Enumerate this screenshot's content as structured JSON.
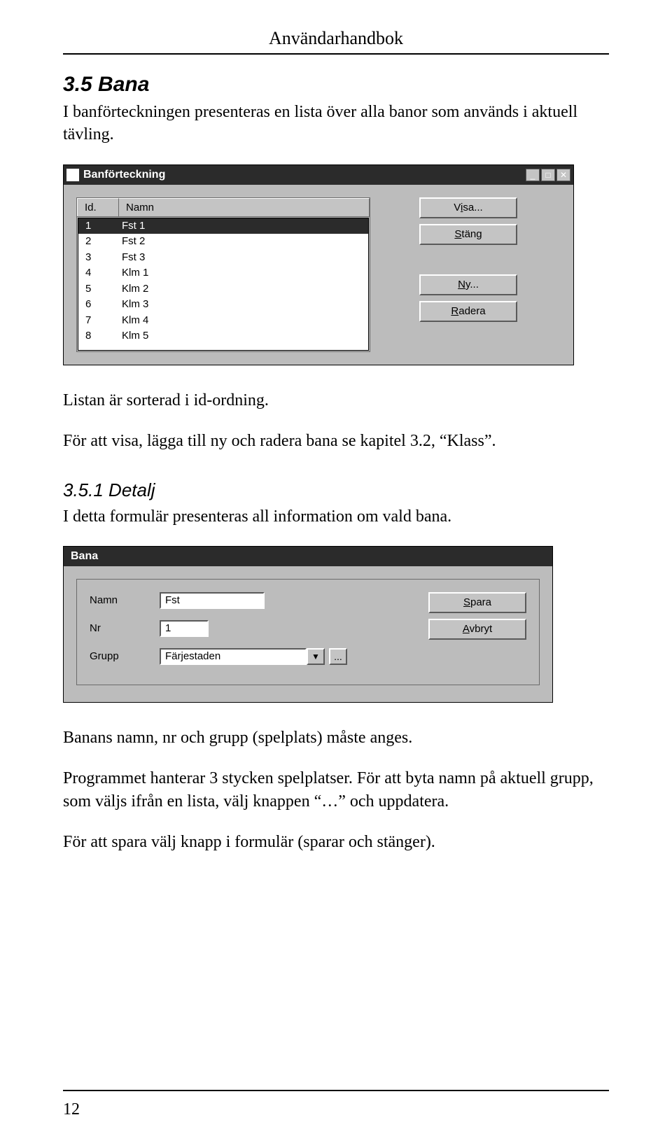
{
  "doc_header": "Användarhandbok",
  "section_3_5": "3.5  Bana",
  "p1": "I banförteckningen presenteras en lista över alla banor som används i aktuell tävling.",
  "win1": {
    "title": "Banförteckning",
    "cols": {
      "id": "Id.",
      "name": "Namn"
    },
    "rows": [
      {
        "id": "1",
        "name": "Fst 1"
      },
      {
        "id": "2",
        "name": "Fst 2"
      },
      {
        "id": "3",
        "name": "Fst 3"
      },
      {
        "id": "4",
        "name": "Klm 1"
      },
      {
        "id": "5",
        "name": "Klm 2"
      },
      {
        "id": "6",
        "name": "Klm 3"
      },
      {
        "id": "7",
        "name": "Klm 4"
      },
      {
        "id": "8",
        "name": "Klm 5"
      }
    ],
    "buttons": {
      "visa_pre": "V",
      "visa_u": "i",
      "visa_post": "sa...",
      "stang_pre": "",
      "stang_u": "S",
      "stang_post": "täng",
      "ny_pre": "",
      "ny_u": "N",
      "ny_post": "y...",
      "radera_pre": "",
      "radera_u": "R",
      "radera_post": "adera"
    }
  },
  "p2": "Listan är sorterad i id-ordning.",
  "p3": "För att visa, lägga till ny och radera bana se kapitel 3.2, “Klass”.",
  "subsection_3_5_1": "3.5.1  Detalj",
  "p4": "I detta formulär presenteras all information om vald bana.",
  "win2": {
    "title": "Bana",
    "labels": {
      "namn": "Namn",
      "nr": "Nr",
      "grupp": "Grupp"
    },
    "values": {
      "namn": "Fst",
      "nr": "1",
      "grupp": "Färjestaden"
    },
    "ellipsis": "...",
    "buttons": {
      "spara_pre": "",
      "spara_u": "S",
      "spara_post": "para",
      "avbryt_pre": "",
      "avbryt_u": "A",
      "avbryt_post": "vbryt"
    }
  },
  "p5": "Banans namn, nr och grupp (spelplats) måste anges.",
  "p6": "Programmet hanterar 3 stycken spelplatser. För att byta namn på aktuell grupp, som väljs ifrån en lista, välj knappen “…” och uppdatera.",
  "p7": "För att spara välj knapp i formulär (sparar och stänger).",
  "page_number": "12"
}
